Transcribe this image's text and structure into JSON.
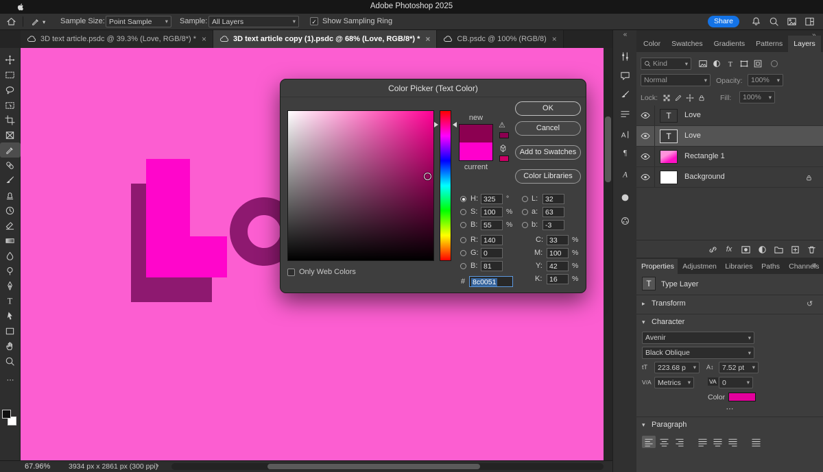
{
  "window": {
    "title": "Adobe Photoshop 2025"
  },
  "options_bar": {
    "sample_size_label": "Sample Size:",
    "sample_size_value": "Point Sample",
    "sample_label": "Sample:",
    "sample_value": "All Layers",
    "show_sampling_ring_label": "Show Sampling Ring",
    "share_label": "Share"
  },
  "document_tabs": [
    {
      "title": "3D text article.psdc @ 39.3% (Love, RGB/8*) *",
      "active": false
    },
    {
      "title": "3D text article copy (1).psdc @ 68% (Love, RGB/8*) *",
      "active": true
    },
    {
      "title": "CB.psdc @ 100% (RGB/8)",
      "active": false
    }
  ],
  "color_picker": {
    "title": "Color Picker (Text Color)",
    "new_label": "new",
    "current_label": "current",
    "ok_label": "OK",
    "cancel_label": "Cancel",
    "add_to_swatches_label": "Add to Swatches",
    "color_libraries_label": "Color Libraries",
    "only_web_colors_label": "Only Web Colors",
    "hex_prefix": "#",
    "hex_value": "8c0051",
    "new_color": "#8c0051",
    "current_color": "#ff00cc",
    "gamut_swatch_color": "#8c0051",
    "web_swatch_color": "#cc0066",
    "fields": {
      "h": {
        "label": "H:",
        "value": "325",
        "unit": "°"
      },
      "s": {
        "label": "S:",
        "value": "100",
        "unit": "%"
      },
      "b": {
        "label": "B:",
        "value": "55",
        "unit": "%"
      },
      "r": {
        "label": "R:",
        "value": "140"
      },
      "g": {
        "label": "G:",
        "value": "0"
      },
      "b2": {
        "label": "B:",
        "value": "81"
      },
      "l": {
        "label": "L:",
        "value": "32"
      },
      "a": {
        "label": "a:",
        "value": "63"
      },
      "b3": {
        "label": "b:",
        "value": "-3"
      },
      "c": {
        "label": "C:",
        "value": "33",
        "unit": "%"
      },
      "m": {
        "label": "M:",
        "value": "100",
        "unit": "%"
      },
      "y": {
        "label": "Y:",
        "value": "42",
        "unit": "%"
      },
      "k": {
        "label": "K:",
        "value": "16",
        "unit": "%"
      }
    }
  },
  "layers_panel": {
    "tabs": [
      "Color",
      "Swatches",
      "Gradients",
      "Patterns",
      "Layers"
    ],
    "kind_label": "Kind",
    "blend_mode": "Normal",
    "opacity_label": "Opacity:",
    "opacity_value": "100%",
    "lock_label": "Lock:",
    "fill_label": "Fill:",
    "fill_value": "100%",
    "layers": [
      {
        "name": "Love"
      },
      {
        "name": "Love"
      },
      {
        "name": "Rectangle 1"
      },
      {
        "name": "Background"
      }
    ]
  },
  "properties_panel": {
    "tabs": [
      "Properties",
      "Adjustmen",
      "Libraries",
      "Paths",
      "Channels"
    ],
    "layer_type_label": "Type Layer",
    "transform_label": "Transform",
    "character_label": "Character",
    "font_family": "Avenir",
    "font_style": "Black Oblique",
    "font_size": "223.68 p",
    "leading": "7.52 pt",
    "tracking": "Metrics",
    "kerning": "0",
    "color_label": "Color",
    "character_color": "#e4009c",
    "paragraph_label": "Paragraph"
  },
  "status_bar": {
    "zoom": "67.96%",
    "doc_info": "3934 px x 2861 px (300 ppi)"
  },
  "canvas": {
    "background": "#fc5ed1",
    "letter_face": "#ff06cb",
    "letter_shadow": "#8e1970"
  },
  "colors": {
    "accent_blue": "#1473e6",
    "selection_blue": "#35639c"
  },
  "icons": {
    "t": "T",
    "fx": "fx",
    "kerning_label": "V/A",
    "tracking_label": "VA",
    "font_size_label": "tT",
    "leading_label": "A↕",
    "chevron_down": "▾",
    "chevron_right": "▸",
    "close": "×",
    "menu": "≡",
    "ellipsis": "⋯",
    "collapse_left": "«",
    "collapse_right": "»",
    "reset": "↺",
    "warning": "⚠",
    "status_chevron": "›",
    "check": "✓"
  }
}
